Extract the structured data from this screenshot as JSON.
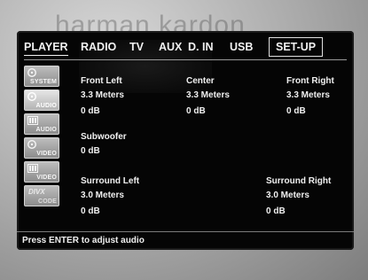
{
  "brand_watermark": "harman kardon",
  "nav": {
    "tabs": [
      {
        "label": "PLAYER"
      },
      {
        "label": "RADIO"
      },
      {
        "label": "TV"
      },
      {
        "label": "AUX"
      },
      {
        "label": "D. IN"
      },
      {
        "label": "USB"
      },
      {
        "label": "SET-UP"
      }
    ],
    "active_tab": "SET-UP"
  },
  "sidebar": {
    "items": [
      {
        "label": "SYSTEM",
        "icon": "disc-icon"
      },
      {
        "label": "AUDIO",
        "icon": "disc-icon",
        "active": true
      },
      {
        "label": "AUDIO",
        "icon": "film-icon"
      },
      {
        "label": "VIDEO",
        "icon": "disc-icon"
      },
      {
        "label": "VIDEO",
        "icon": "film-icon"
      },
      {
        "label": "CODE",
        "icon": "divx-logo",
        "logo_text": "DIVX"
      }
    ]
  },
  "channels": {
    "front_left": {
      "name": "Front Left",
      "distance": "3.3 Meters",
      "level": "0 dB"
    },
    "center": {
      "name": "Center",
      "distance": "3.3 Meters",
      "level": "0 dB"
    },
    "front_right": {
      "name": "Front Right",
      "distance": "3.3 Meters",
      "level": "0 dB"
    },
    "subwoofer": {
      "name": "Subwoofer",
      "level": "0 dB"
    },
    "surround_left": {
      "name": "Surround Left",
      "distance": "3.0 Meters",
      "level": "0 dB"
    },
    "surround_right": {
      "name": "Surround Right",
      "distance": "3.0 Meters",
      "level": "0 dB"
    }
  },
  "status": "Press ENTER to adjust audio",
  "colors": {
    "screen_bg": "#050505",
    "text": "#f0f0f0",
    "sidebar_button": "#a6a6a6"
  }
}
